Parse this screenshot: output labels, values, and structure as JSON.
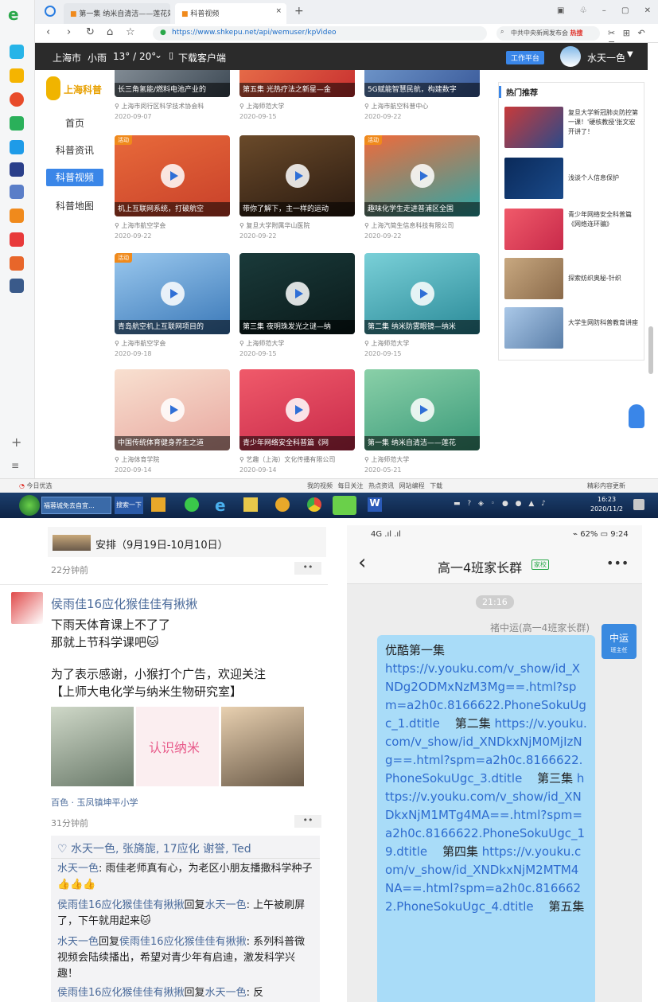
{
  "browser": {
    "tabs": [
      "第一集 纳米自清洁——莲花效",
      "科普视频"
    ],
    "url": "https://www.shkepu.net/api/wemuser/kpVideo",
    "search_placeholder": "中共中央新闻发布会",
    "search_hot": "热搜",
    "site": {
      "city": "上海市",
      "weather": "小雨",
      "temp": "13° / 20°",
      "download": "下载客户端",
      "work_platform": "工作平台",
      "username": "水天一色"
    },
    "logo": "上海科普",
    "nav": [
      "首页",
      "科普资讯",
      "科普视频",
      "科普地图"
    ],
    "cards": [
      {
        "title": "长三角氢能/燃料电池产业的",
        "source": "上海市闵行区科学技术协会科",
        "date": "2020-09-07"
      },
      {
        "title": "第五集 光热疗法之新星—金",
        "source": "上海师范大学",
        "date": "2020-09-15"
      },
      {
        "title": "5G赋能智慧民航，构建数字",
        "source": "上海市航空科普中心",
        "date": "2020-09-22"
      },
      {
        "title": "机上互联网系统，打破航空",
        "source": "上海市航空学会",
        "date": "2020-09-22",
        "badge": "活动"
      },
      {
        "title": "带你了解下，主一样的运动",
        "source": "复旦大学附属华山医院",
        "date": "2020-09-22"
      },
      {
        "title": "趣味化学生走进普浦区全国",
        "source": "上海汽简生信息科技有限公司",
        "date": "2020-09-22",
        "badge": "活动"
      },
      {
        "title": "青岛航空机上互联网项目的",
        "source": "上海市航空学会",
        "date": "2020-09-18",
        "badge": "活动"
      },
      {
        "title": "第三集 夜明珠发光之谜—纳",
        "source": "上海师范大学",
        "date": "2020-09-15"
      },
      {
        "title": "第二集 纳米防雾眼镜—纳米",
        "source": "上海师范大学",
        "date": "2020-09-15"
      },
      {
        "title": "中国传统体育健身养生之道",
        "source": "上海体育学院",
        "date": "2020-09-14"
      },
      {
        "title": "青少年网络安全科普篇《网",
        "source": "艺趣（上海）文化传播有限公司",
        "date": "2020-09-14"
      },
      {
        "title": "第一集 纳米自清洁——莲花",
        "source": "上海师范大学",
        "date": "2020-05-21"
      }
    ],
    "hot": {
      "title": "热门推荐",
      "items": [
        "复旦大学新冠肺炎防控第一课！'硬核教授'张文宏开讲了！",
        "浅谈个人信息保护",
        "青少年网络安全科普篇《网络连环骗》",
        "探索纺织奥秘-针织",
        "大学生网防科普教育讲座"
      ]
    },
    "status_left": "今日优选",
    "status_right": [
      "我的视频",
      "每日关注",
      "热点资讯",
      "网站编程",
      "下载"
    ],
    "status_news": "精彩内容更新",
    "task_items": [
      "福蓉城免去自宜...",
      "搜索一下"
    ],
    "clock_time": "16:23",
    "clock_date": "2020/11/2"
  },
  "chatL": {
    "top_post": "安排（9月19日-10月10日）",
    "top_time": "22分钟前",
    "author": "侯雨佳16应化猴佳佳有揪揪",
    "line1": "下雨天体育课上不了了",
    "line2": "那就上节科学课吧🐱",
    "line3": "为了表示感谢，小猴打个广告，欢迎关注",
    "line4": "【上师大电化学与纳米生物研究室】",
    "img_mid": "认识纳米",
    "location": "百色 · 玉凤镇坤平小学",
    "time": "31分钟前",
    "likes": "水天一色, 张旖旎, 17应化 谢誉, Ted",
    "comments": [
      {
        "name": "水天一色",
        "text": ": 雨佳老师真有心，为老区小朋友播撒科学种子 👍👍👍"
      },
      {
        "name": "侯雨佳16应化猴佳佳有揪揪",
        "mid": "回复",
        "to": "水天一色",
        "text": ": 上午被刷屏了，下午就用起来🐱"
      },
      {
        "name": "水天一色",
        "mid": "回复",
        "to": "侯雨佳16应化猴佳佳有揪揪",
        "text": ": 系列科普微视频会陆续播出，希望对青少年有启迪，激发科学兴趣！"
      },
      {
        "name": "侯雨佳16应化猴佳佳有揪揪",
        "mid": "回复",
        "to": "水天一色",
        "text": ": 反"
      }
    ]
  },
  "chatR": {
    "status_left": "4G .ıl .ıl",
    "battery": "62%",
    "clock": "9:24",
    "title": "高一4班家长群",
    "title_tag": "家校",
    "timestamp": "21:16",
    "sender": "褚中运(高一4班家长群)",
    "avatar_name": "中运",
    "avatar_role": "班主任",
    "bubble_head": "优酷第一集",
    "links": [
      "https://v.youku.com/v_show/id_XNDg2ODMxNzM3Mg==.html?spm=a2h0c.8166622.PhoneSokuUgc_1.dtitle",
      "https://v.youku.com/v_show/id_XNDkxNjM0MjIzNg==.html?spm=a2h0c.8166622.PhoneSokuUgc_3.dtitle",
      "https://v.youku.com/v_show/id_XNDkxNjM1MTg4MA==.html?spm=a2h0c.8166622.PhoneSokuUgc_19.dtitle",
      "https://v.youku.com/v_show/id_XNDkxNjM2MTM4NA==.html?spm=a2h0c.8166622.PhoneSokuUgc_4.dtitle"
    ],
    "episodes": [
      "第二集",
      "第三集",
      "第四集",
      "第五集"
    ]
  },
  "colors": {
    "accent": "#3a86e8",
    "dark_header": "#2b2b2b",
    "link": "#2d6bcf",
    "bubble": "#a9dcf8"
  }
}
